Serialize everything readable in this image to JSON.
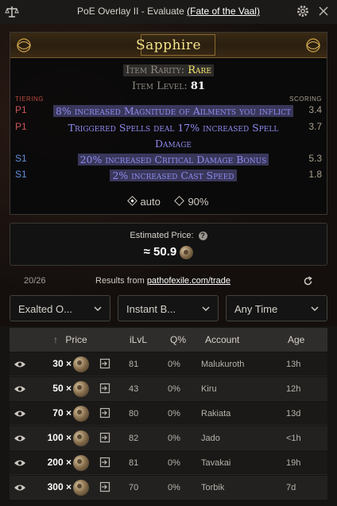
{
  "window": {
    "title_prefix": "PoE Overlay II - Evaluate",
    "title_league": "(Fate of the Vaal)"
  },
  "item": {
    "name": "Sapphire",
    "rarity_label": "Item Rarity:",
    "rarity_value": "Rare",
    "level_label": "Item Level:",
    "level_value": "81",
    "tiering_label": "TIERING",
    "scoring_label": "SCORING",
    "mods": [
      {
        "tier": "P1",
        "kind": "prefix",
        "text": "8% increased Magnitude of Ailments you inflict",
        "score": "3.4"
      },
      {
        "tier": "P1",
        "kind": "prefix",
        "text_line1": "Triggered Spells deal 17% increased Spell",
        "text_line2": "Damage",
        "score": "3.7"
      },
      {
        "tier": "S1",
        "kind": "suffix",
        "text": "20% increased Critical Damage Bonus",
        "score": "5.3"
      },
      {
        "tier": "S1",
        "kind": "suffix",
        "text": "2% increased Cast Speed",
        "score": "1.8"
      }
    ],
    "options": [
      {
        "label": "auto",
        "selected": true
      },
      {
        "label": "90%",
        "selected": false
      }
    ]
  },
  "estimate": {
    "label": "Estimated Price:",
    "help": "?",
    "value": "≈ 50.9"
  },
  "results": {
    "count": "20/26",
    "from_label": "Results from",
    "source": "pathofexile.com/trade"
  },
  "filters": {
    "currency": "Exalted O...",
    "listing": "Instant B...",
    "time": "Any Time"
  },
  "table": {
    "headers": {
      "price": "Price",
      "ilvl": "iLvL",
      "quality": "Q%",
      "account": "Account",
      "age": "Age"
    },
    "rows": [
      {
        "price": "30 ×",
        "ilvl": "81",
        "quality": "0%",
        "account": "Malukuroth",
        "age": "13h"
      },
      {
        "price": "50 ×",
        "ilvl": "43",
        "quality": "0%",
        "account": "Kiru",
        "age": "12h"
      },
      {
        "price": "70 ×",
        "ilvl": "80",
        "quality": "0%",
        "account": "Rakiata",
        "age": "13d"
      },
      {
        "price": "100 ×",
        "ilvl": "82",
        "quality": "0%",
        "account": "Jado",
        "age": "<1h"
      },
      {
        "price": "200 ×",
        "ilvl": "81",
        "quality": "0%",
        "account": "Tavakai",
        "age": "19h"
      },
      {
        "price": "300 ×",
        "ilvl": "70",
        "quality": "0%",
        "account": "Torbik",
        "age": "7d"
      }
    ]
  },
  "colors": {
    "rare": "#f3e66a",
    "mod_text": "#8f8bef",
    "prefix_tier": "#c8545a",
    "suffix_tier": "#5f8fd9"
  }
}
